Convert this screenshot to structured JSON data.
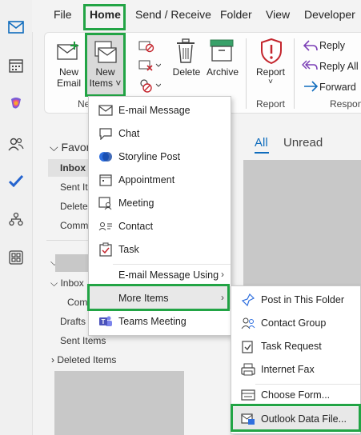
{
  "tabs": [
    "File",
    "Home",
    "Send / Receive",
    "Folder",
    "View",
    "Developer"
  ],
  "ribbon": {
    "new_email": [
      "New",
      "Email"
    ],
    "new_items": [
      "New",
      "Items ˅"
    ],
    "new_group_label": "Ne",
    "delete": "Delete",
    "archive": "Archive",
    "report": [
      "Report",
      "˅"
    ],
    "report_group_label": "Report",
    "reply": "Reply",
    "reply_all": "Reply All",
    "forward": "Forward",
    "respond_group_label": "Respon"
  },
  "folder_pane": {
    "favorites_header": "Favor",
    "favorites": [
      "Inbox",
      "Sent Item",
      "Delete",
      "Comm"
    ],
    "inbox": "Inbox",
    "inbox_child": "Com",
    "drafts": "Drafts",
    "sent_items": "Sent Items",
    "deleted_items": "Deleted Items"
  },
  "message_list": {
    "filter_all": "All",
    "filter_unread": "Unread"
  },
  "new_items_menu": {
    "items": [
      {
        "label": "E-mail Message",
        "icon": "envelope-icon"
      },
      {
        "label": "Chat",
        "icon": "chat-icon"
      },
      {
        "label": "Storyline Post",
        "icon": "storyline-icon"
      },
      {
        "label": "Appointment",
        "icon": "calendar-icon"
      },
      {
        "label": "Meeting",
        "icon": "meeting-icon"
      },
      {
        "label": "Contact",
        "icon": "contact-card-icon"
      },
      {
        "label": "Task",
        "icon": "task-icon"
      },
      {
        "label": "E-mail Message Using",
        "icon": ""
      },
      {
        "label": "More Items",
        "icon": ""
      },
      {
        "label": "Teams Meeting",
        "icon": "teams-icon"
      }
    ]
  },
  "more_items_menu": {
    "items": [
      {
        "label": "Post in This Folder",
        "icon": "post-icon"
      },
      {
        "label": "Contact Group",
        "icon": "contact-group-icon"
      },
      {
        "label": "Task Request",
        "icon": "task-request-icon"
      },
      {
        "label": "Internet Fax",
        "icon": "fax-icon"
      },
      {
        "label": "Choose Form...",
        "icon": "form-icon"
      },
      {
        "label": "Outlook Data File...",
        "icon": "data-file-icon"
      }
    ]
  },
  "colors": {
    "highlight": "#22a445",
    "accent": "#0f6cbd",
    "selected_row": "#e1e1e1"
  }
}
